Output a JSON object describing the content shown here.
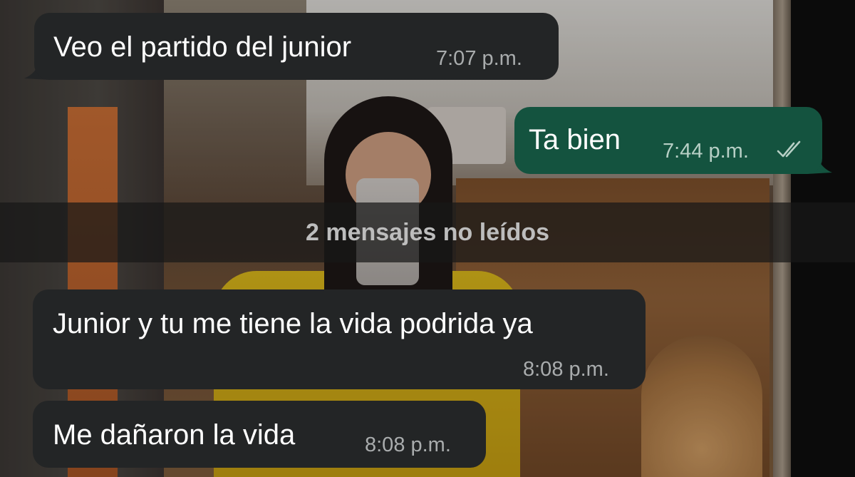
{
  "unread_divider": {
    "label": "2 mensajes no leídos"
  },
  "messages": [
    {
      "direction": "incoming",
      "text": "Veo el partido del junior",
      "time": "7:07 p.m."
    },
    {
      "direction": "outgoing",
      "text": "Ta bien",
      "time": "7:44 p.m.",
      "status_icon": "double-check-icon"
    },
    {
      "direction": "incoming",
      "text": "Junior y tu me tiene la vida podrida ya",
      "time": "8:08 p.m."
    },
    {
      "direction": "incoming",
      "text": "Me dañaron la vida",
      "time": "8:08 p.m."
    }
  ],
  "colors": {
    "incoming_bubble": "#232526",
    "outgoing_bubble": "#14533f",
    "timestamp": "#a9acad"
  }
}
